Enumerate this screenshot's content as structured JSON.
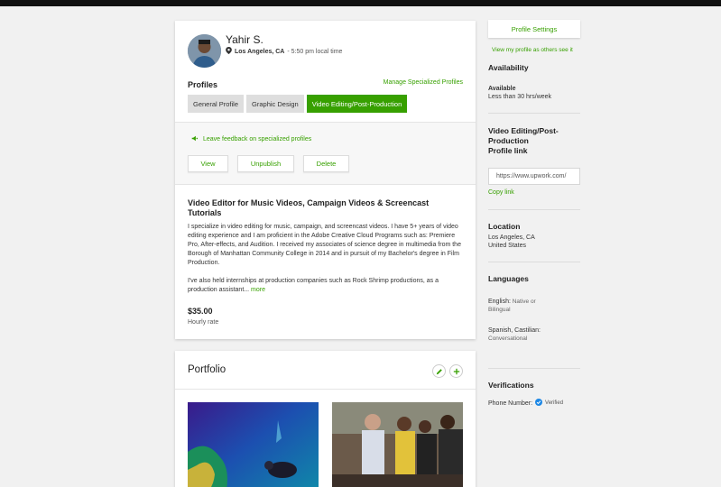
{
  "profile": {
    "name": "Yahir S.",
    "city": "Los Angeles, CA",
    "local_time": " - 5:50 pm local time",
    "profiles_label": "Profiles",
    "manage_link": "Manage Specialized Profiles",
    "tabs": [
      {
        "label": "General Profile",
        "active": false
      },
      {
        "label": "Graphic Design",
        "active": false
      },
      {
        "label": "Video Editing/Post-Production",
        "active": true
      }
    ],
    "feedback_link": "Leave feedback on specialized profiles",
    "actions": {
      "view": "View",
      "unpublish": "Unpublish",
      "delete": "Delete"
    },
    "title": "Video Editor for Music Videos, Campaign Videos & Screencast Tutorials",
    "description_1": "I specialize in video editing for music, campaign, and screencast videos. I have 5+ years of video editing experience and I am proficient in the Adobe Creative Cloud Programs such as: Premiere Pro, After-effects, and Audition. I received my associates of science degree in multimedia from the Borough of Manhattan Community College in 2014 and in pursuit of my Bachelor's degree in Film Production.",
    "description_2": "I've also held internships at production companies such as Rock Shrimp productions, as a production assistant...",
    "more_link": "more",
    "rate": "$35.00",
    "rate_label": "Hourly rate"
  },
  "portfolio": {
    "title": "Portfolio"
  },
  "sidebar": {
    "settings_button": "Profile Settings",
    "view_as_link": "View my profile as others see it",
    "availability_head": "Availability",
    "availability_status": "Available",
    "availability_hours": "Less than 30 hrs/week",
    "profile_link_head_1": "Video Editing/Post-",
    "profile_link_head_2": "Production",
    "profile_link_head_3": "Profile link",
    "profile_url": "https://www.upwork.com/",
    "copy_link": "Copy link",
    "location_head": "Location",
    "location_city": "Los Angeles, CA",
    "location_country": "United States",
    "languages_head": "Languages",
    "lang_1_name": "English:",
    "lang_1_level_a": " Native or",
    "lang_1_level_b": "Bilingual",
    "lang_2_name": "Spanish, Castilian:",
    "lang_2_level": "Conversational",
    "verifications_head": "Verifications",
    "phone_label": "Phone Number:",
    "verified_tag": "Verified"
  },
  "colors": {
    "accent": "#37a000",
    "verified": "#1e88e5",
    "tab_inactive": "#dedede"
  },
  "icons": [
    "location-pin-icon",
    "feedback-megaphone-icon",
    "pencil-icon",
    "plus-icon",
    "verified-check-icon"
  ]
}
